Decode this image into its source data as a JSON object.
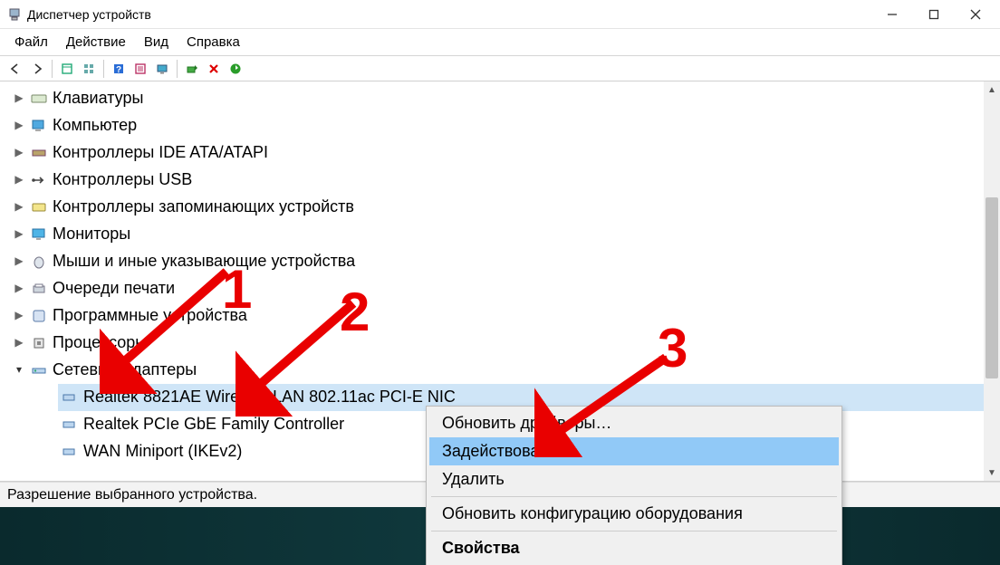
{
  "window": {
    "title": "Диспетчер устройств"
  },
  "menubar": {
    "file": "Файл",
    "action": "Действие",
    "view": "Вид",
    "help": "Справка"
  },
  "tree": {
    "items": [
      {
        "icon": "keyboard",
        "label": "Клавиатуры"
      },
      {
        "icon": "computer",
        "label": "Компьютер"
      },
      {
        "icon": "ide",
        "label": "Контроллеры IDE ATA/ATAPI"
      },
      {
        "icon": "usb",
        "label": "Контроллеры USB"
      },
      {
        "icon": "storage",
        "label": "Контроллеры запоминающих устройств"
      },
      {
        "icon": "monitor",
        "label": "Мониторы"
      },
      {
        "icon": "mouse",
        "label": "Мыши и иные указывающие устройства"
      },
      {
        "icon": "printq",
        "label": "Очереди печати"
      },
      {
        "icon": "software",
        "label": "Программные устройства"
      },
      {
        "icon": "cpu",
        "label": "Процессоры"
      }
    ],
    "expanded": {
      "label": "Сетевые адаптеры",
      "children": [
        {
          "label": "Realtek 8821AE Wireless LAN 802.11ac PCI-E NIC",
          "selected": true
        },
        {
          "label": "Realtek PCIe GbE Family Controller"
        },
        {
          "label": "WAN Miniport (IKEv2)"
        }
      ]
    }
  },
  "context_menu": {
    "update": "Обновить драйверы…",
    "enable": "Задействовать",
    "delete": "Удалить",
    "scan": "Обновить конфигурацию оборудования",
    "props": "Свойства"
  },
  "statusbar": {
    "text": "Разрешение выбранного устройства."
  },
  "annotations": {
    "n1": "1",
    "n2": "2",
    "n3": "3"
  }
}
